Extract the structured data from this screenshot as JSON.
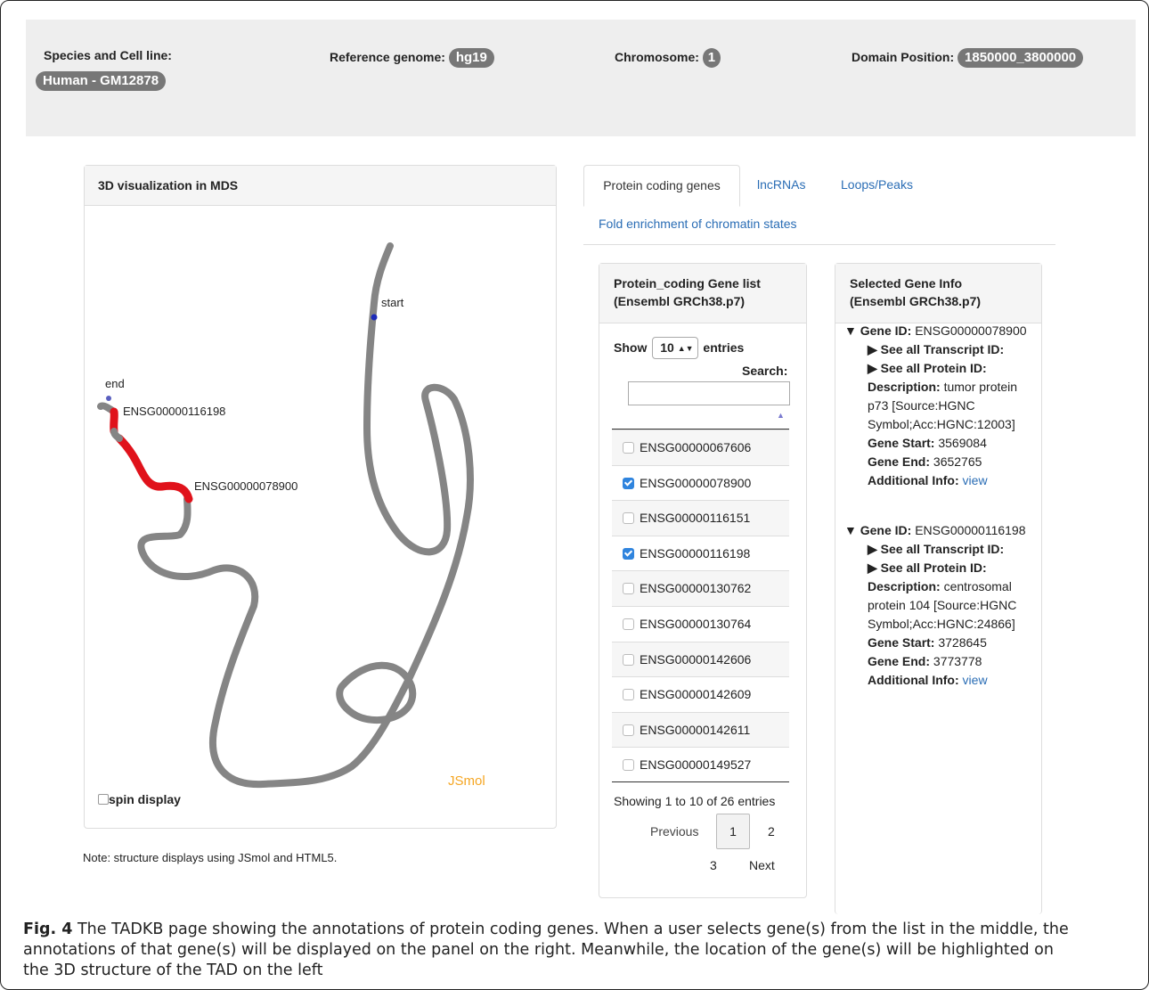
{
  "header": {
    "species_label": "Species and Cell line:",
    "species_value": "Human - GM12878",
    "ref_label": "Reference genome:",
    "ref_value": "hg19",
    "chrom_label": "Chromosome:",
    "chrom_value": "1",
    "domain_label": "Domain Position:",
    "domain_value": "1850000_3800000"
  },
  "viz": {
    "title": "3D visualization in MDS",
    "labels": {
      "start": "start",
      "end": "end",
      "gene1": "ENSG00000116198",
      "gene2": "ENSG00000078900"
    },
    "brand": "JSmol",
    "spin_label": "spin display",
    "note": "Note: structure displays using JSmol and HTML5."
  },
  "tabs": {
    "protein": "Protein coding genes",
    "lncrnas": "lncRNAs",
    "loops": "Loops/Peaks",
    "fold": "Fold enrichment of chromatin states"
  },
  "gene_list": {
    "title_line1": "Protein_coding Gene list",
    "title_line2": "(Ensembl GRCh38.p7)",
    "show": "Show",
    "entries_value": "10",
    "entries": "entries",
    "search": "Search:",
    "rows": [
      {
        "id": "ENSG00000067606",
        "checked": false
      },
      {
        "id": "ENSG00000078900",
        "checked": true
      },
      {
        "id": "ENSG00000116151",
        "checked": false
      },
      {
        "id": "ENSG00000116198",
        "checked": true
      },
      {
        "id": "ENSG00000130762",
        "checked": false
      },
      {
        "id": "ENSG00000130764",
        "checked": false
      },
      {
        "id": "ENSG00000142606",
        "checked": false
      },
      {
        "id": "ENSG00000142609",
        "checked": false
      },
      {
        "id": "ENSG00000142611",
        "checked": false
      },
      {
        "id": "ENSG00000149527",
        "checked": false
      }
    ],
    "showing": "Showing 1 to 10 of 26 entries",
    "previous": "Previous",
    "page1": "1",
    "page2": "2",
    "page3": "3",
    "next": "Next"
  },
  "gene_info": {
    "title_line1": "Selected Gene Info",
    "title_line2": "(Ensembl GRCh38.p7)",
    "genes": [
      {
        "gene_id_label": "Gene ID:",
        "gene_id": "ENSG00000078900",
        "transcript": "See all Transcript ID:",
        "protein": "See all Protein ID:",
        "desc_label": "Description:",
        "desc_1": "tumor protein",
        "desc_2": "p73 [Source:HGNC",
        "desc_3": "Symbol;Acc:HGNC:12003]",
        "start_label": "Gene Start:",
        "start": "3569084",
        "end_label": "Gene End:",
        "end": "3652765",
        "add_label": "Additional Info:",
        "add_link": "view"
      },
      {
        "gene_id_label": "Gene ID:",
        "gene_id": "ENSG00000116198",
        "transcript": "See all Transcript ID:",
        "protein": "See all Protein ID:",
        "desc_label": "Description:",
        "desc_1": "centrosomal",
        "desc_2": "protein 104 [Source:HGNC",
        "desc_3": "Symbol;Acc:HGNC:24866]",
        "start_label": "Gene Start:",
        "start": "3728645",
        "end_label": "Gene End:",
        "end": "3773778",
        "add_label": "Additional Info:",
        "add_link": "view"
      }
    ]
  },
  "caption": {
    "fig": "Fig. 4",
    "text_1": "The TADKB page showing the annotations of protein coding genes. When a user selects gene(s) from the list in the middle, the",
    "text_2": "annotations of that gene(s) will be displayed on the panel on the right. Meanwhile, the location of the gene(s) will be highlighted on",
    "text_3": "the 3D structure of the TAD on the left"
  },
  "colors": {
    "highlight": "#e0121b",
    "strand": "#858585",
    "brand": "#f5a623",
    "link": "#2a6db5"
  }
}
